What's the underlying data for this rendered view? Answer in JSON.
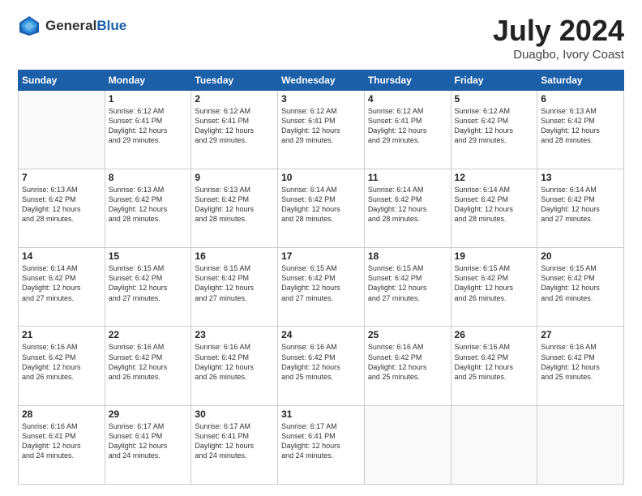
{
  "header": {
    "logo_line1": "General",
    "logo_line2": "Blue",
    "month": "July 2024",
    "location": "Duagbo, Ivory Coast"
  },
  "weekdays": [
    "Sunday",
    "Monday",
    "Tuesday",
    "Wednesday",
    "Thursday",
    "Friday",
    "Saturday"
  ],
  "weeks": [
    [
      {
        "day": "",
        "info": ""
      },
      {
        "day": "1",
        "info": "Sunrise: 6:12 AM\nSunset: 6:41 PM\nDaylight: 12 hours\nand 29 minutes."
      },
      {
        "day": "2",
        "info": "Sunrise: 6:12 AM\nSunset: 6:41 PM\nDaylight: 12 hours\nand 29 minutes."
      },
      {
        "day": "3",
        "info": "Sunrise: 6:12 AM\nSunset: 6:41 PM\nDaylight: 12 hours\nand 29 minutes."
      },
      {
        "day": "4",
        "info": "Sunrise: 6:12 AM\nSunset: 6:41 PM\nDaylight: 12 hours\nand 29 minutes."
      },
      {
        "day": "5",
        "info": "Sunrise: 6:12 AM\nSunset: 6:42 PM\nDaylight: 12 hours\nand 29 minutes."
      },
      {
        "day": "6",
        "info": "Sunrise: 6:13 AM\nSunset: 6:42 PM\nDaylight: 12 hours\nand 28 minutes."
      }
    ],
    [
      {
        "day": "7",
        "info": "Sunrise: 6:13 AM\nSunset: 6:42 PM\nDaylight: 12 hours\nand 28 minutes."
      },
      {
        "day": "8",
        "info": "Sunrise: 6:13 AM\nSunset: 6:42 PM\nDaylight: 12 hours\nand 28 minutes."
      },
      {
        "day": "9",
        "info": "Sunrise: 6:13 AM\nSunset: 6:42 PM\nDaylight: 12 hours\nand 28 minutes."
      },
      {
        "day": "10",
        "info": "Sunrise: 6:14 AM\nSunset: 6:42 PM\nDaylight: 12 hours\nand 28 minutes."
      },
      {
        "day": "11",
        "info": "Sunrise: 6:14 AM\nSunset: 6:42 PM\nDaylight: 12 hours\nand 28 minutes."
      },
      {
        "day": "12",
        "info": "Sunrise: 6:14 AM\nSunset: 6:42 PM\nDaylight: 12 hours\nand 28 minutes."
      },
      {
        "day": "13",
        "info": "Sunrise: 6:14 AM\nSunset: 6:42 PM\nDaylight: 12 hours\nand 27 minutes."
      }
    ],
    [
      {
        "day": "14",
        "info": "Sunrise: 6:14 AM\nSunset: 6:42 PM\nDaylight: 12 hours\nand 27 minutes."
      },
      {
        "day": "15",
        "info": "Sunrise: 6:15 AM\nSunset: 6:42 PM\nDaylight: 12 hours\nand 27 minutes."
      },
      {
        "day": "16",
        "info": "Sunrise: 6:15 AM\nSunset: 6:42 PM\nDaylight: 12 hours\nand 27 minutes."
      },
      {
        "day": "17",
        "info": "Sunrise: 6:15 AM\nSunset: 6:42 PM\nDaylight: 12 hours\nand 27 minutes."
      },
      {
        "day": "18",
        "info": "Sunrise: 6:15 AM\nSunset: 6:42 PM\nDaylight: 12 hours\nand 27 minutes."
      },
      {
        "day": "19",
        "info": "Sunrise: 6:15 AM\nSunset: 6:42 PM\nDaylight: 12 hours\nand 26 minutes."
      },
      {
        "day": "20",
        "info": "Sunrise: 6:15 AM\nSunset: 6:42 PM\nDaylight: 12 hours\nand 26 minutes."
      }
    ],
    [
      {
        "day": "21",
        "info": "Sunrise: 6:16 AM\nSunset: 6:42 PM\nDaylight: 12 hours\nand 26 minutes."
      },
      {
        "day": "22",
        "info": "Sunrise: 6:16 AM\nSunset: 6:42 PM\nDaylight: 12 hours\nand 26 minutes."
      },
      {
        "day": "23",
        "info": "Sunrise: 6:16 AM\nSunset: 6:42 PM\nDaylight: 12 hours\nand 26 minutes."
      },
      {
        "day": "24",
        "info": "Sunrise: 6:16 AM\nSunset: 6:42 PM\nDaylight: 12 hours\nand 25 minutes."
      },
      {
        "day": "25",
        "info": "Sunrise: 6:16 AM\nSunset: 6:42 PM\nDaylight: 12 hours\nand 25 minutes."
      },
      {
        "day": "26",
        "info": "Sunrise: 6:16 AM\nSunset: 6:42 PM\nDaylight: 12 hours\nand 25 minutes."
      },
      {
        "day": "27",
        "info": "Sunrise: 6:16 AM\nSunset: 6:42 PM\nDaylight: 12 hours\nand 25 minutes."
      }
    ],
    [
      {
        "day": "28",
        "info": "Sunrise: 6:16 AM\nSunset: 6:41 PM\nDaylight: 12 hours\nand 24 minutes."
      },
      {
        "day": "29",
        "info": "Sunrise: 6:17 AM\nSunset: 6:41 PM\nDaylight: 12 hours\nand 24 minutes."
      },
      {
        "day": "30",
        "info": "Sunrise: 6:17 AM\nSunset: 6:41 PM\nDaylight: 12 hours\nand 24 minutes."
      },
      {
        "day": "31",
        "info": "Sunrise: 6:17 AM\nSunset: 6:41 PM\nDaylight: 12 hours\nand 24 minutes."
      },
      {
        "day": "",
        "info": ""
      },
      {
        "day": "",
        "info": ""
      },
      {
        "day": "",
        "info": ""
      }
    ]
  ]
}
